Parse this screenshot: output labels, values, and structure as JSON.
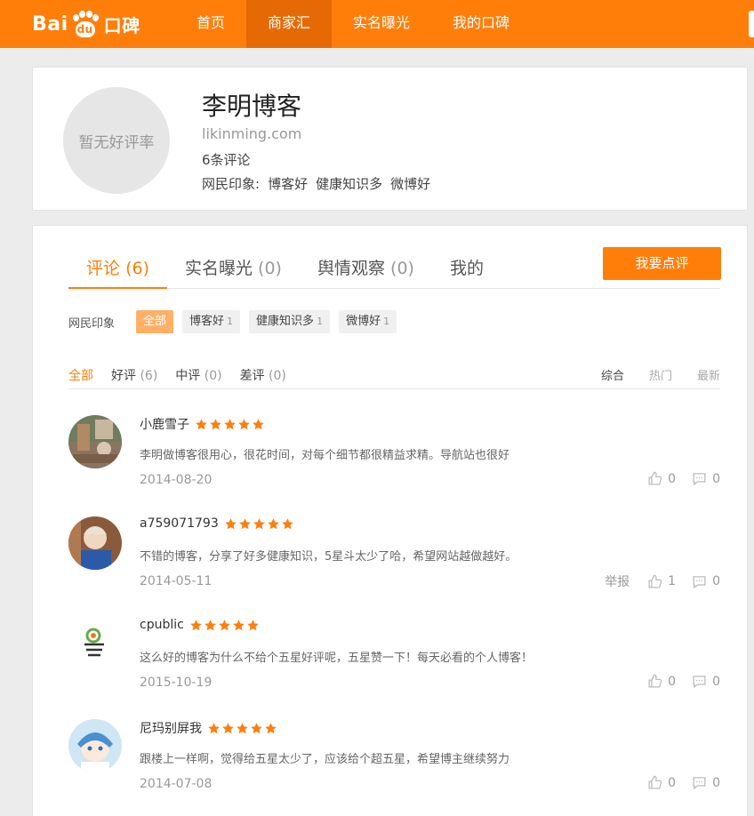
{
  "header": {
    "logo_left": "Bai",
    "logo_paw": "du",
    "logo_right": "口碑",
    "nav": [
      {
        "label": "首页",
        "active": false
      },
      {
        "label": "商家汇",
        "active": true
      },
      {
        "label": "实名曝光",
        "active": false
      },
      {
        "label": "我的口碑",
        "active": false
      }
    ]
  },
  "profile": {
    "avatar_text": "暂无好评率",
    "name": "李明博客",
    "domain": "likinming.com",
    "review_count": "6条评论",
    "impression_label": "网民印象:",
    "impressions": [
      "博客好",
      "健康知识多",
      "微博好"
    ]
  },
  "tabs": [
    {
      "label": "评论",
      "count": "(6)",
      "active": true
    },
    {
      "label": "实名曝光",
      "count": "(0)",
      "active": false
    },
    {
      "label": "舆情观察",
      "count": "(0)",
      "active": false
    },
    {
      "label": "我的",
      "count": "",
      "active": false
    }
  ],
  "write_review_label": "我要点评",
  "impression_row": {
    "label": "网民印象",
    "tags": [
      {
        "label": "全部",
        "count": "",
        "active": true
      },
      {
        "label": "博客好",
        "count": "1",
        "active": false
      },
      {
        "label": "健康知识多",
        "count": "1",
        "active": false
      },
      {
        "label": "微博好",
        "count": "1",
        "active": false
      }
    ]
  },
  "filters": [
    {
      "label": "全部",
      "count": "",
      "active": true
    },
    {
      "label": "好评",
      "count": "(6)",
      "active": false
    },
    {
      "label": "中评",
      "count": "(0)",
      "active": false
    },
    {
      "label": "差评",
      "count": "(0)",
      "active": false
    }
  ],
  "sorts": [
    {
      "label": "综合",
      "active": true
    },
    {
      "label": "热门",
      "active": false
    },
    {
      "label": "最新",
      "active": false
    }
  ],
  "reviews": [
    {
      "user": "小鹿雪子",
      "rating": 5,
      "text": "李明做博客很用心，很花时间，对每个细节都很精益求精。导航站也很好",
      "date": "2014-08-20",
      "report": "",
      "likes": "0",
      "comments": "0"
    },
    {
      "user": "a759071793",
      "rating": 5,
      "text": "不错的博客，分享了好多健康知识，5星斗太少了哈，希望网站越做越好。",
      "date": "2014-05-11",
      "report": "举报",
      "likes": "1",
      "comments": "0"
    },
    {
      "user": "cpublic",
      "rating": 5,
      "text": "这么好的博客为什么不给个五星好评呢，五星赞一下！每天必看的个人博客！",
      "date": "2015-10-19",
      "report": "",
      "likes": "0",
      "comments": "0"
    },
    {
      "user": "尼玛别屏我",
      "rating": 5,
      "text": "跟楼上一样啊，觉得给五星太少了，应该给个超五星，希望博主继续努力",
      "date": "2014-07-08",
      "report": "",
      "likes": "0",
      "comments": "0"
    }
  ],
  "colors": {
    "brand": "#ff7e0a",
    "star": "#ff7e0a"
  }
}
